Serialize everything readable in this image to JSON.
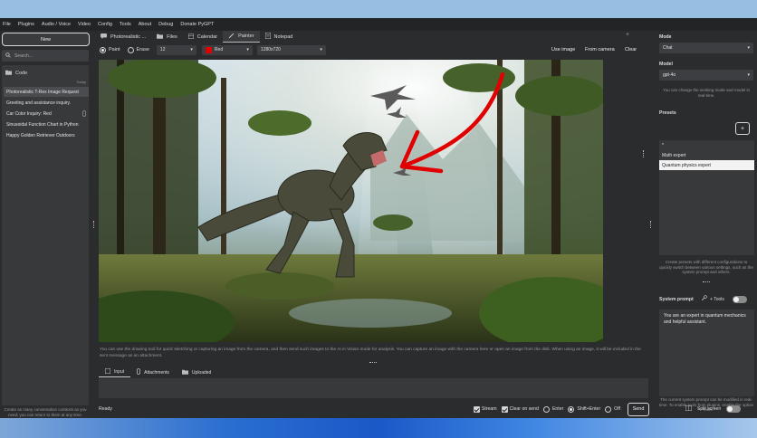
{
  "menu": [
    "File",
    "Plugins",
    "Audio / Voice",
    "Video",
    "Config",
    "Tools",
    "About",
    "Debug",
    "Donate PyGPT"
  ],
  "left": {
    "new_label": "New",
    "search_placeholder": "Search...",
    "folder": "Code",
    "today": "Today",
    "conversations": [
      "Photorealistic T-Rex Image Request",
      "Greeting and assistance inquiry.",
      "Car Color Inquiry: Red",
      "Sinusoidal Function Chart in Python",
      "Happy Golden Retriever Outdoors"
    ],
    "info": "Create as many conversation contexts as you need; you can return to them at any time."
  },
  "tabs": [
    "Photorealistic ...",
    "Files",
    "Calendar",
    "Painter",
    "Notepad"
  ],
  "painter": {
    "paint": "Paint",
    "erase": "Erase",
    "brush_size": "12",
    "color": "Red",
    "canvas_size": "1280x720",
    "use_image": "Use image",
    "from_camera": "From camera",
    "clear": "Clear",
    "hint": "You can use the drawing tool for quick sketching or capturing an image from the camera, and then send such images to the AI in Vision mode for analysis. You can capture an image with the camera here or open an image from the disk. When using an image, it will be included in the sent message as an attachment."
  },
  "input_tabs": [
    "Input",
    "Attachments",
    "Uploaded"
  ],
  "status": {
    "ready": "Ready",
    "stream": "Stream",
    "clear_on_send": "Clear on send",
    "enter": "Enter",
    "shift_enter": "Shift+Enter",
    "off": "Off",
    "send": "Send"
  },
  "right": {
    "mode_label": "Mode",
    "mode_value": "Chat",
    "model_label": "Model",
    "model_value": "gpt-4o",
    "model_info": "You can change the working mode and model in real-time.",
    "presets_label": "Presets",
    "plus": "+",
    "presets": [
      "*",
      "Math expert",
      "Quantum physics expert"
    ],
    "presets_info": "Create presets with different configurations to quickly switch between various settings, such as the system prompt and others.",
    "system_prompt_label": "System prompt",
    "tools_label": "+ Tools",
    "system_prompt": "You are an expert in quantum mechanics and helpful assistant.",
    "system_info": "The current system prompt can be modified in real-time. To enable tools from plugins, enable the option \"+ Tools.\"",
    "split_screen": "Split screen"
  },
  "colors": {
    "accent_red": "#e00000",
    "bg": "#2b2c2e",
    "panel": "#38393b"
  }
}
